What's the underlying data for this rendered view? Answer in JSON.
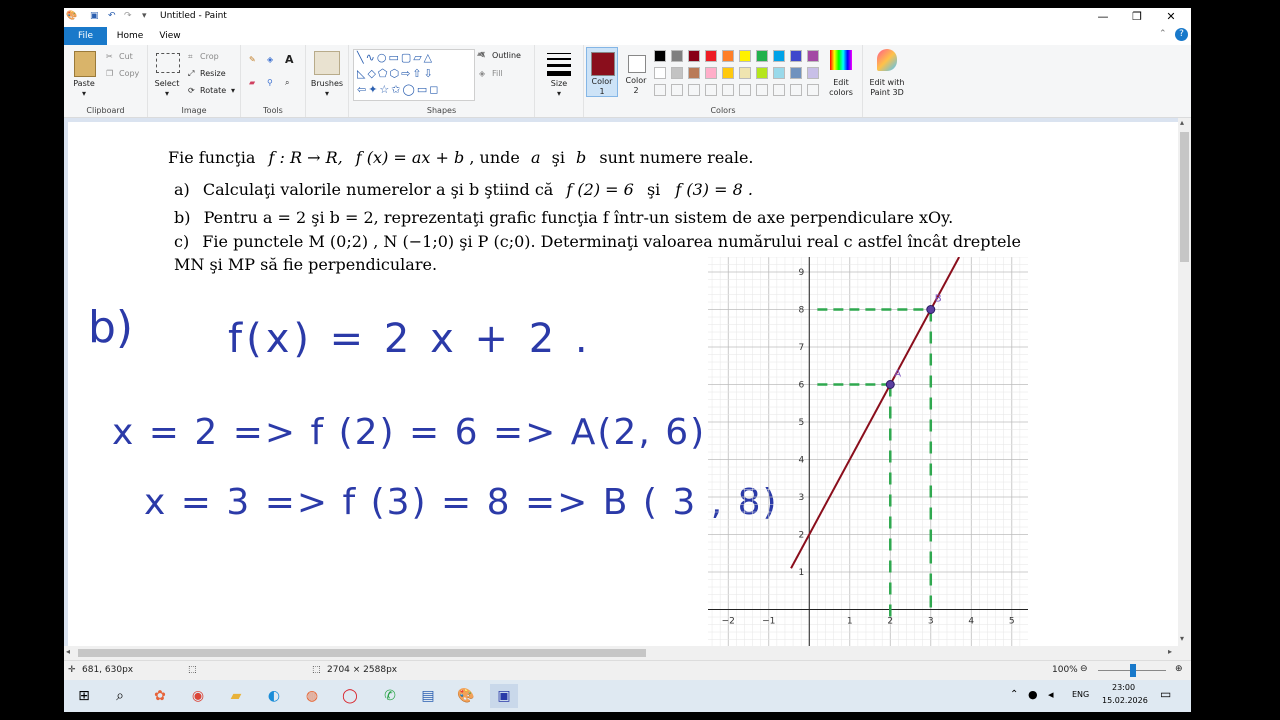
{
  "window": {
    "title": "Untitled - Paint",
    "controls": {
      "minimize": "—",
      "maximize": "❐",
      "close": "✕"
    }
  },
  "tabs": [
    {
      "label": "File"
    },
    {
      "label": "Home"
    },
    {
      "label": "View"
    }
  ],
  "ribbon": {
    "clipboard": {
      "group": "Clipboard",
      "paste": "Paste",
      "cut": "Cut",
      "copy": "Copy"
    },
    "image": {
      "group": "Image",
      "select": "Select",
      "crop": "Crop",
      "resize": "Resize",
      "rotate": "Rotate"
    },
    "tools": {
      "group": "Tools"
    },
    "brushes": {
      "label": "Brushes"
    },
    "shapes": {
      "group": "Shapes",
      "outline": "Outline",
      "fill": "Fill"
    },
    "size": {
      "label": "Size"
    },
    "colors": {
      "group": "Colors",
      "color1_label": "Color",
      "color1_num": "1",
      "color2_label": "Color",
      "color2_num": "2",
      "color1": "#8a0e1c",
      "color2": "#ffffff",
      "edit_colors_1": "Edit",
      "edit_colors_2": "colors",
      "paint3d_1": "Edit with",
      "paint3d_2": "Paint 3D",
      "palette_row1": [
        "#000000",
        "#7f7f7f",
        "#880015",
        "#ed1c24",
        "#ff7f27",
        "#fff200",
        "#22b14c",
        "#00a2e8",
        "#3f48cc",
        "#a349a4"
      ],
      "palette_row2": [
        "#ffffff",
        "#c3c3c3",
        "#b97a57",
        "#ffaec9",
        "#ffc90e",
        "#efe4b0",
        "#b5e61d",
        "#99d9ea",
        "#7092be",
        "#c8bfe7"
      ]
    }
  },
  "document": {
    "line1": {
      "pre": "Fie funcţia",
      "f_sig": "f : R → R,",
      "f_def": "f (x) = ax + b",
      "post": ", unde",
      "a": "a",
      "si": "şi",
      "b": "b",
      "tail": "sunt numere reale."
    },
    "item_a": {
      "marker": "a)",
      "text": "Calculaţi valorile numerelor a şi b ştiind că",
      "cond1": "f (2) = 6",
      "si": "şi",
      "cond2": "f (3) = 8 ."
    },
    "item_b": {
      "marker": "b)",
      "text": "Pentru  a = 2 şi b = 2, reprezentaţi grafic funcţia f într-un sistem de axe perpendiculare xOy."
    },
    "item_c": {
      "marker": "c)",
      "text": "Fie punctele  M (0;2) , N (−1;0) şi P (c;0). Determinaţi valoarea numărului real c astfel încât dreptele",
      "text2": "MN şi MP să fie perpendiculare."
    }
  },
  "handwriting": {
    "label": "b)",
    "line1": "f(x) = 2 x + 2 .",
    "line2": "x = 2 => f (2) = 6 => A(2, 6)",
    "line3": "x = 3 => f (3) = 8 => B ( 3 , 8)"
  },
  "chart_data": {
    "type": "line",
    "x_ticks": [
      "−2",
      "−1",
      "1",
      "2",
      "3",
      "4",
      "5"
    ],
    "y_ticks": [
      "1",
      "2",
      "3",
      "4",
      "5",
      "6",
      "7",
      "8",
      "9"
    ],
    "xlim": [
      -2.5,
      5.4
    ],
    "ylim": [
      -1,
      9.4
    ],
    "grid": true,
    "series": [
      {
        "points": [
          [
            -0.45,
            1.1
          ],
          [
            3.7,
            9.4
          ]
        ],
        "color": "#8a0e1c"
      }
    ],
    "points": [
      {
        "label": "A",
        "x": 2,
        "y": 6
      },
      {
        "label": "B",
        "x": 3,
        "y": 8
      }
    ],
    "guide_color": "#2fa84f"
  },
  "status": {
    "cursor_pos": "681, 630px",
    "image_size": "2704 × 2588px",
    "zoom": "100%"
  },
  "taskbar": {
    "lang": "ENG",
    "time": "23:00",
    "date": "15.02.2026"
  }
}
